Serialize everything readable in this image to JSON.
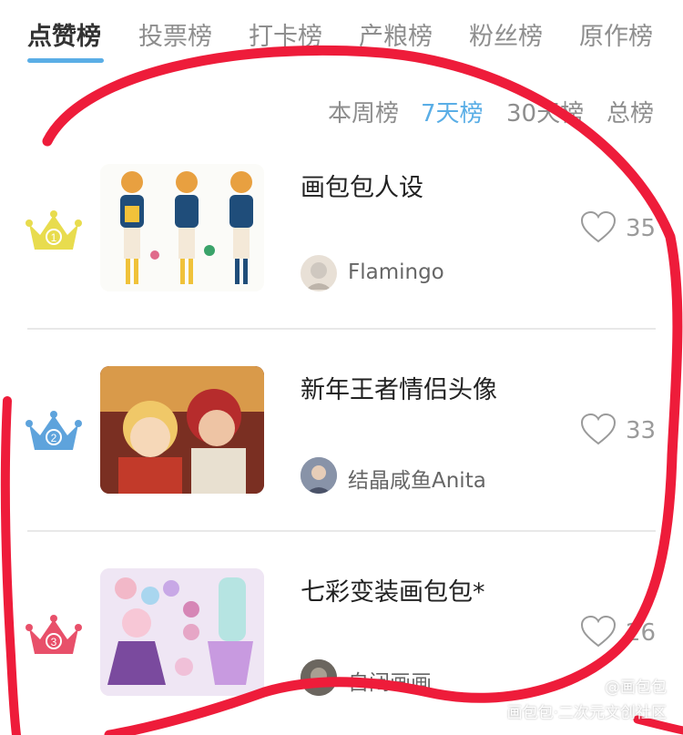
{
  "tabs": [
    {
      "label": "点赞榜",
      "active": true
    },
    {
      "label": "投票榜",
      "active": false
    },
    {
      "label": "打卡榜",
      "active": false
    },
    {
      "label": "产粮榜",
      "active": false
    },
    {
      "label": "粉丝榜",
      "active": false
    },
    {
      "label": "原作榜",
      "active": false
    }
  ],
  "periods": [
    {
      "label": "本周榜",
      "active": false
    },
    {
      "label": "7天榜",
      "active": true
    },
    {
      "label": "30天榜",
      "active": false
    },
    {
      "label": "总榜",
      "active": false
    }
  ],
  "ranking": [
    {
      "rank": 1,
      "title": "画包包人设",
      "author": "Flamingo",
      "likes": "35",
      "crown_color": "#e8dc4e",
      "crown_icon": "crown-gold-icon"
    },
    {
      "rank": 2,
      "title": "新年王者情侣头像",
      "author": "结晶咸鱼Anita",
      "likes": "33",
      "crown_color": "#5ea3dc",
      "crown_icon": "crown-silver-icon"
    },
    {
      "rank": 3,
      "title": "七彩变装画包包*",
      "author": "自闭画画",
      "likes": "26",
      "crown_color": "#e8506a",
      "crown_icon": "crown-bronze-icon"
    }
  ],
  "watermark": {
    "handle": "@画包包",
    "site": "画包包·二次元文创社区"
  },
  "colors": {
    "accent": "#5aaee6",
    "scribble": "#ee1c3a"
  }
}
